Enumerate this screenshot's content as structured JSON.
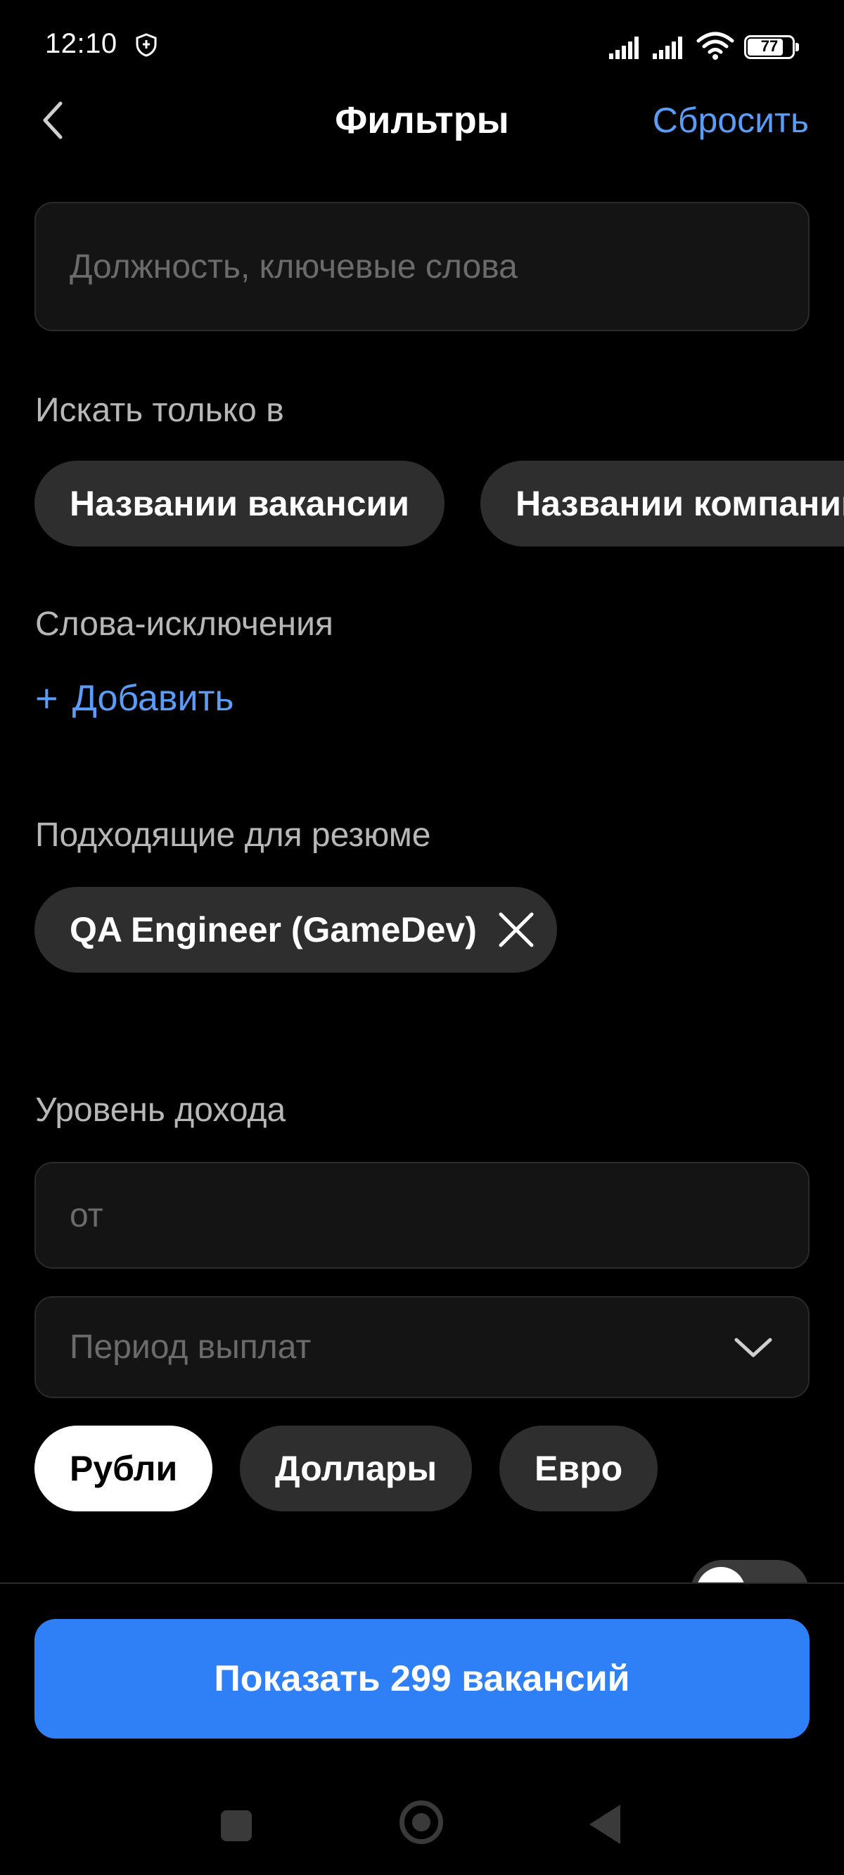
{
  "status_bar": {
    "time": "12:10",
    "battery": "77"
  },
  "header": {
    "title": "Фильтры",
    "reset_label": "Сбросить"
  },
  "search": {
    "placeholder": "Должность, ключевые слова"
  },
  "search_in": {
    "label": "Искать только в",
    "chips": [
      "Названии вакансии",
      "Названии компании"
    ]
  },
  "exclude_words": {
    "label": "Слова-исключения",
    "add_label": "Добавить"
  },
  "resume": {
    "label": "Подходящие для резюме",
    "selected": "QA Engineer (GameDev)"
  },
  "income": {
    "label": "Уровень дохода",
    "from_placeholder": "от",
    "period_placeholder": "Период выплат",
    "currencies": [
      "Рубли",
      "Доллары",
      "Евро"
    ],
    "selected_currency": "Рубли"
  },
  "footer": {
    "show_button": "Показать 299 вакансий"
  },
  "colors": {
    "accent": "#2f80f7",
    "link": "#5a9cf8",
    "background": "#000000",
    "chip": "#2e2e2e"
  }
}
